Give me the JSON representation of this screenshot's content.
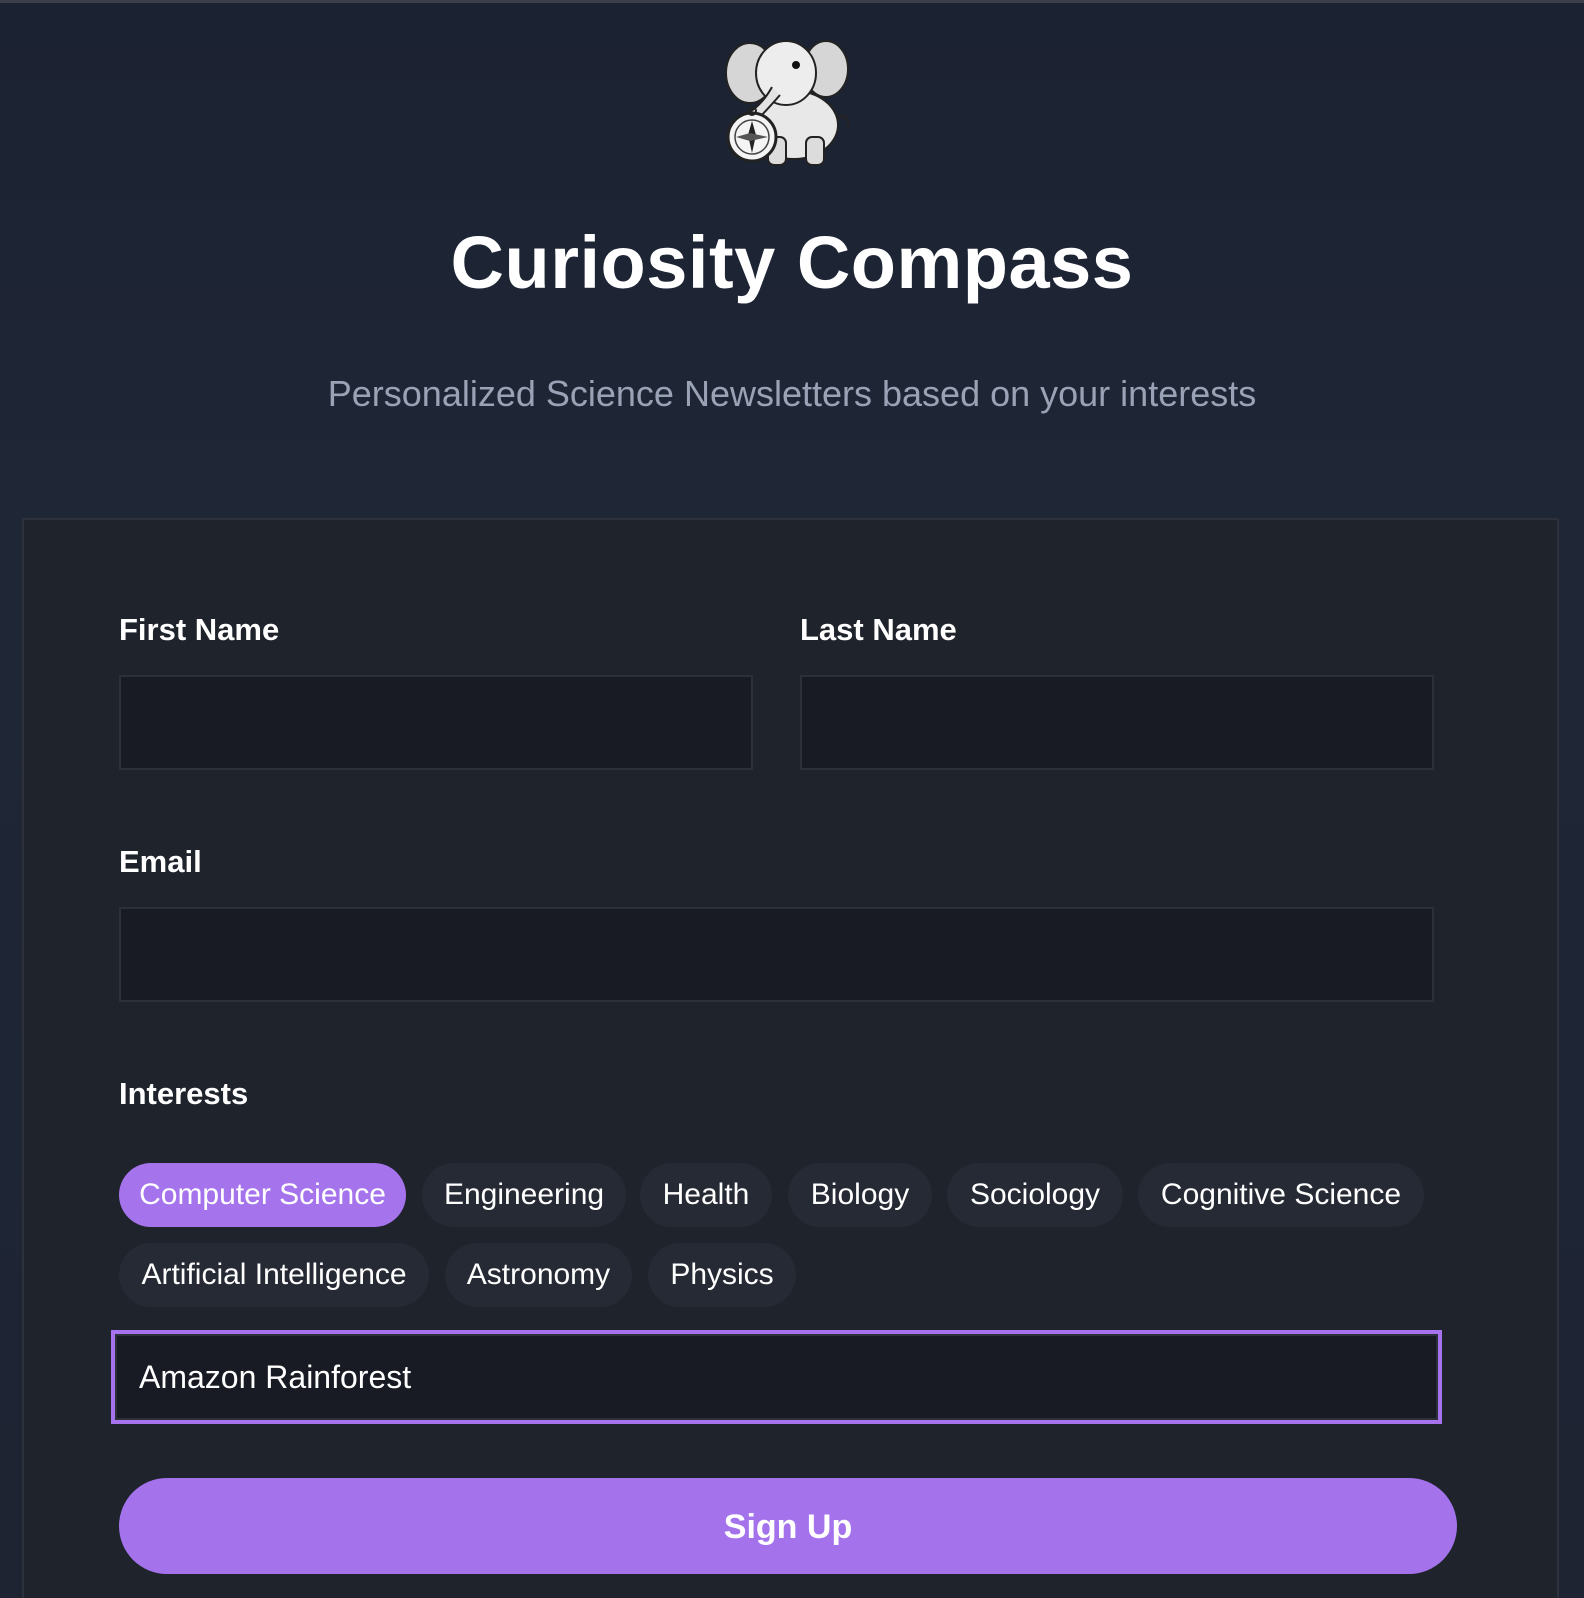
{
  "header": {
    "logo_icon": "elephant-with-compass-logo",
    "title": "Curiosity Compass",
    "subtitle": "Personalized Science Newsletters based on your interests"
  },
  "form": {
    "first_name": {
      "label": "First Name",
      "value": ""
    },
    "last_name": {
      "label": "Last Name",
      "value": ""
    },
    "email": {
      "label": "Email",
      "value": ""
    },
    "interests": {
      "label": "Interests",
      "chips": [
        {
          "label": "Computer Science",
          "selected": true
        },
        {
          "label": "Engineering",
          "selected": false
        },
        {
          "label": "Health",
          "selected": false
        },
        {
          "label": "Biology",
          "selected": false
        },
        {
          "label": "Sociology",
          "selected": false
        },
        {
          "label": "Cognitive Science",
          "selected": false
        },
        {
          "label": "Artificial Intelligence",
          "selected": false
        },
        {
          "label": "Astronomy",
          "selected": false
        },
        {
          "label": "Physics",
          "selected": false
        }
      ],
      "custom_input_value": "Amazon Rainforest"
    },
    "submit_label": "Sign Up"
  },
  "colors": {
    "accent": "#a574ec",
    "background": "#1e2432",
    "card": "#1f232c",
    "input": "#181b23",
    "chip": "#262a34",
    "subtitle": "#9aa3b5"
  }
}
